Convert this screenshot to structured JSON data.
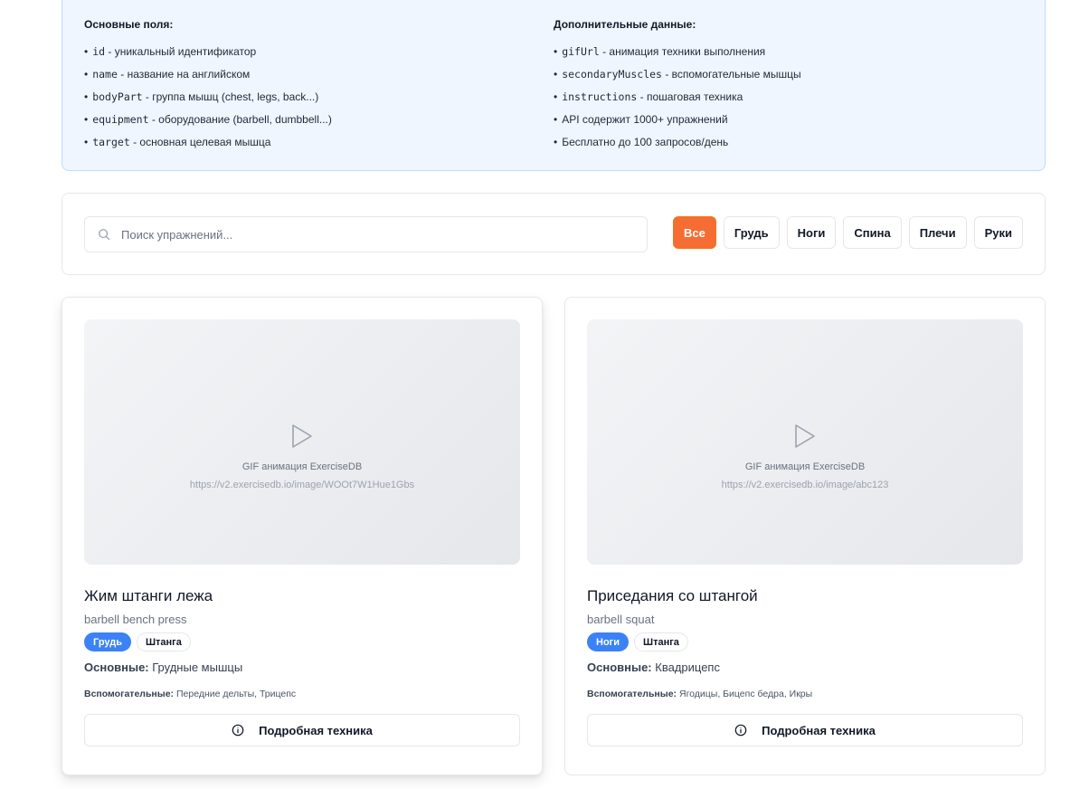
{
  "info": {
    "left_title": "Основные поля:",
    "left_items": [
      {
        "code": "id",
        "text": " - уникальный идентификатор"
      },
      {
        "code": "name",
        "text": " - название на английском"
      },
      {
        "code": "bodyPart",
        "text": " - группа мышц (chest, legs, back...)"
      },
      {
        "code": "equipment",
        "text": " - оборудование (barbell, dumbbell...)"
      },
      {
        "code": "target",
        "text": " - основная целевая мышца"
      }
    ],
    "right_title": "Дополнительные данные:",
    "right_items": [
      {
        "code": "gifUrl",
        "text": " - анимация техники выполнения"
      },
      {
        "code": "secondaryMuscles",
        "text": " - вспомогательные мышцы"
      },
      {
        "code": "instructions",
        "text": " - пошаговая техника"
      },
      {
        "code": "",
        "text": "API содержит 1000+ упражнений"
      },
      {
        "code": "",
        "text": "Бесплатно до 100 запросов/день"
      }
    ]
  },
  "search": {
    "placeholder": "Поиск упражнений...",
    "value": ""
  },
  "filters": [
    {
      "label": "Все",
      "active": true
    },
    {
      "label": "Грудь",
      "active": false
    },
    {
      "label": "Ноги",
      "active": false
    },
    {
      "label": "Спина",
      "active": false
    },
    {
      "label": "Плечи",
      "active": false
    },
    {
      "label": "Руки",
      "active": false
    }
  ],
  "cards": [
    {
      "media_caption": "GIF анимация ExerciseDB",
      "media_url": "https://v2.exercisedb.io/image/WOOt7W1Hue1Gbs",
      "title": "Жим штанги лежа",
      "name_en": "barbell bench press",
      "tag_primary": "Грудь",
      "tag_secondary": "Штанга",
      "main_label": "Основные:",
      "main_value": " Грудные мышцы",
      "aux_label": "Вспомогательные:",
      "aux_value": " Передние дельты, Трицепс",
      "button_label": "Подробная техника"
    },
    {
      "media_caption": "GIF анимация ExerciseDB",
      "media_url": "https://v2.exercisedb.io/image/abc123",
      "title": "Приседания со штангой",
      "name_en": "barbell squat",
      "tag_primary": "Ноги",
      "tag_secondary": "Штанга",
      "main_label": "Основные:",
      "main_value": " Квадрицепс",
      "aux_label": "Вспомогательные:",
      "aux_value": " Ягодицы, Бицепс бедра, Икры",
      "button_label": "Подробная техника"
    }
  ],
  "colors": {
    "accent": "#f56d33",
    "primary_tag": "#3b82f6",
    "info_bg": "#eff6ff"
  },
  "icons": {
    "search": "search-icon",
    "play": "play-icon",
    "info": "info-circle-icon"
  }
}
